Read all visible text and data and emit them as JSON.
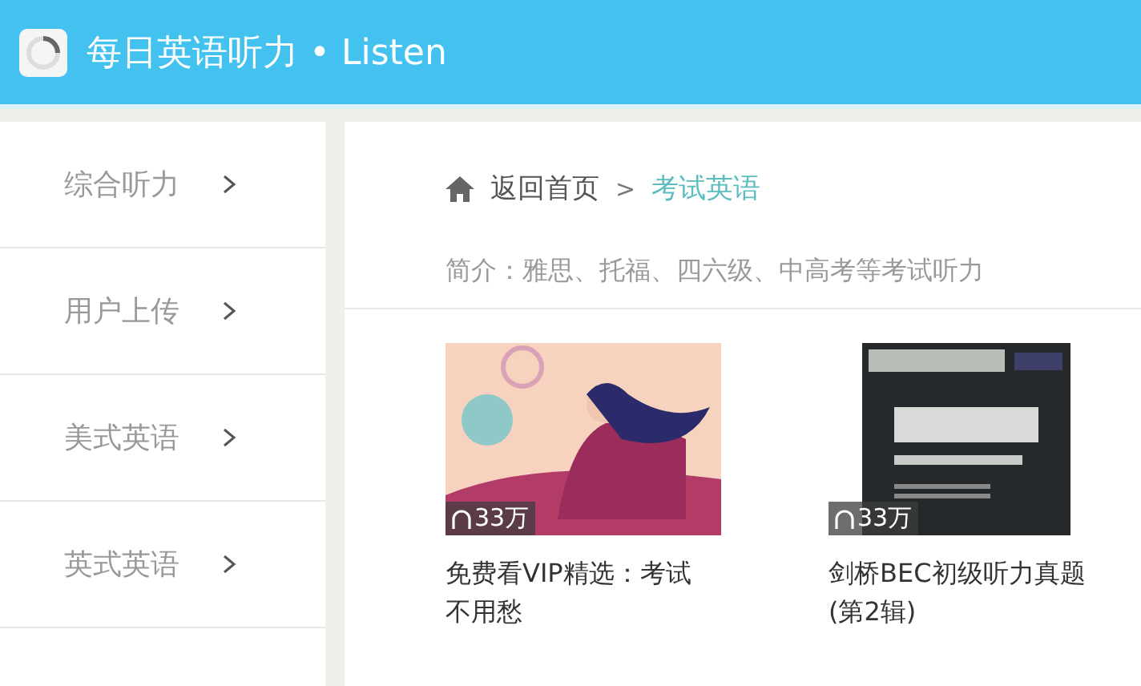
{
  "header": {
    "title": "每日英语听力 • Listen"
  },
  "sidebar": {
    "items": [
      {
        "label": "综合听力",
        "selected": false
      },
      {
        "label": "用户上传",
        "selected": false
      },
      {
        "label": "美式英语",
        "selected": false
      },
      {
        "label": "英式英语",
        "selected": false
      }
    ]
  },
  "breadcrumb": {
    "home": "返回首页",
    "separator": ">",
    "current": "考试英语"
  },
  "intro": "简介：雅思、托福、四六级、中高考等考试听力",
  "cards": [
    {
      "kind": "illustration",
      "plays": "33万",
      "title": "免费看VIP精选：考试不用愁"
    },
    {
      "kind": "book",
      "plays": "33万",
      "title": "剑桥BEC初级听力真题 (第2辑)"
    }
  ]
}
